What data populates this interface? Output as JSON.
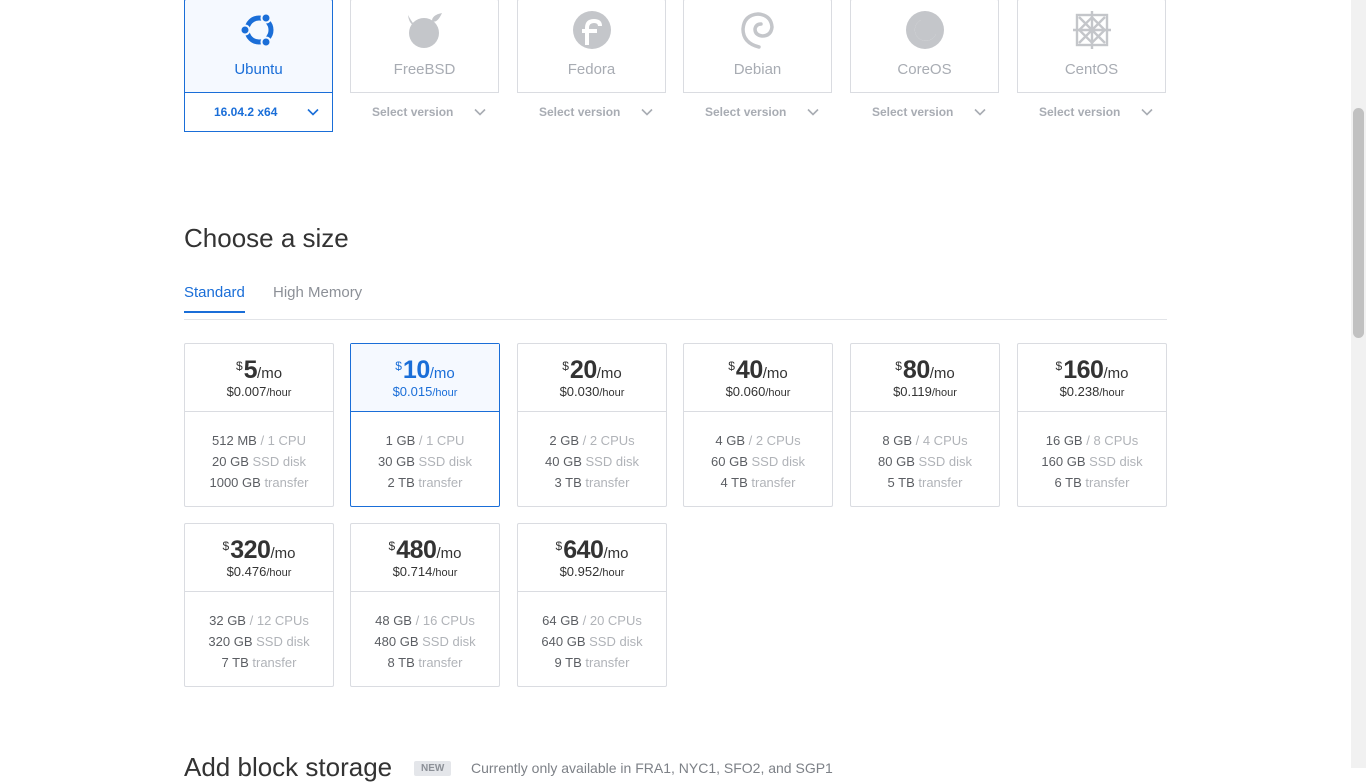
{
  "distros": [
    {
      "name": "Ubuntu",
      "version": "16.04.2 x64",
      "icon": "ubuntu-icon",
      "selected": true
    },
    {
      "name": "FreeBSD",
      "version": "Select version",
      "icon": "freebsd-icon",
      "selected": false
    },
    {
      "name": "Fedora",
      "version": "Select version",
      "icon": "fedora-icon",
      "selected": false
    },
    {
      "name": "Debian",
      "version": "Select version",
      "icon": "debian-icon",
      "selected": false
    },
    {
      "name": "CoreOS",
      "version": "Select version",
      "icon": "coreos-icon",
      "selected": false
    },
    {
      "name": "CentOS",
      "version": "Select version",
      "icon": "centos-icon",
      "selected": false
    }
  ],
  "size_section": {
    "title": "Choose a size",
    "tabs": [
      {
        "label": "Standard",
        "active": true
      },
      {
        "label": "High Memory",
        "active": false
      }
    ]
  },
  "sizes": [
    {
      "currency": "$",
      "amount": "5",
      "per": "/mo",
      "hourly": "$0.007",
      "hourly_unit": "/hour",
      "memory": "512 MB",
      "cpu": "/ 1 CPU",
      "disk": "20 GB",
      "disk_label": "SSD disk",
      "transfer": "1000 GB",
      "transfer_label": "transfer",
      "selected": false
    },
    {
      "currency": "$",
      "amount": "10",
      "per": "/mo",
      "hourly": "$0.015",
      "hourly_unit": "/hour",
      "memory": "1 GB",
      "cpu": "/ 1 CPU",
      "disk": "30 GB",
      "disk_label": "SSD disk",
      "transfer": "2 TB",
      "transfer_label": "transfer",
      "selected": true
    },
    {
      "currency": "$",
      "amount": "20",
      "per": "/mo",
      "hourly": "$0.030",
      "hourly_unit": "/hour",
      "memory": "2 GB",
      "cpu": "/ 2 CPUs",
      "disk": "40 GB",
      "disk_label": "SSD disk",
      "transfer": "3 TB",
      "transfer_label": "transfer",
      "selected": false
    },
    {
      "currency": "$",
      "amount": "40",
      "per": "/mo",
      "hourly": "$0.060",
      "hourly_unit": "/hour",
      "memory": "4 GB",
      "cpu": "/ 2 CPUs",
      "disk": "60 GB",
      "disk_label": "SSD disk",
      "transfer": "4 TB",
      "transfer_label": "transfer",
      "selected": false
    },
    {
      "currency": "$",
      "amount": "80",
      "per": "/mo",
      "hourly": "$0.119",
      "hourly_unit": "/hour",
      "memory": "8 GB",
      "cpu": "/ 4 CPUs",
      "disk": "80 GB",
      "disk_label": "SSD disk",
      "transfer": "5 TB",
      "transfer_label": "transfer",
      "selected": false
    },
    {
      "currency": "$",
      "amount": "160",
      "per": "/mo",
      "hourly": "$0.238",
      "hourly_unit": "/hour",
      "memory": "16 GB",
      "cpu": "/ 8 CPUs",
      "disk": "160 GB",
      "disk_label": "SSD disk",
      "transfer": "6 TB",
      "transfer_label": "transfer",
      "selected": false
    },
    {
      "currency": "$",
      "amount": "320",
      "per": "/mo",
      "hourly": "$0.476",
      "hourly_unit": "/hour",
      "memory": "32 GB",
      "cpu": "/ 12 CPUs",
      "disk": "320 GB",
      "disk_label": "SSD disk",
      "transfer": "7 TB",
      "transfer_label": "transfer",
      "selected": false
    },
    {
      "currency": "$",
      "amount": "480",
      "per": "/mo",
      "hourly": "$0.714",
      "hourly_unit": "/hour",
      "memory": "48 GB",
      "cpu": "/ 16 CPUs",
      "disk": "480 GB",
      "disk_label": "SSD disk",
      "transfer": "8 TB",
      "transfer_label": "transfer",
      "selected": false
    },
    {
      "currency": "$",
      "amount": "640",
      "per": "/mo",
      "hourly": "$0.952",
      "hourly_unit": "/hour",
      "memory": "64 GB",
      "cpu": "/ 20 CPUs",
      "disk": "640 GB",
      "disk_label": "SSD disk",
      "transfer": "9 TB",
      "transfer_label": "transfer",
      "selected": false
    }
  ],
  "block_storage": {
    "title": "Add block storage",
    "badge": "NEW",
    "note": "Currently only available in FRA1, NYC1, SFO2, and SGP1"
  },
  "colors": {
    "accent": "#1a6ed8",
    "border": "#dadce1",
    "muted": "#a8acb3"
  }
}
